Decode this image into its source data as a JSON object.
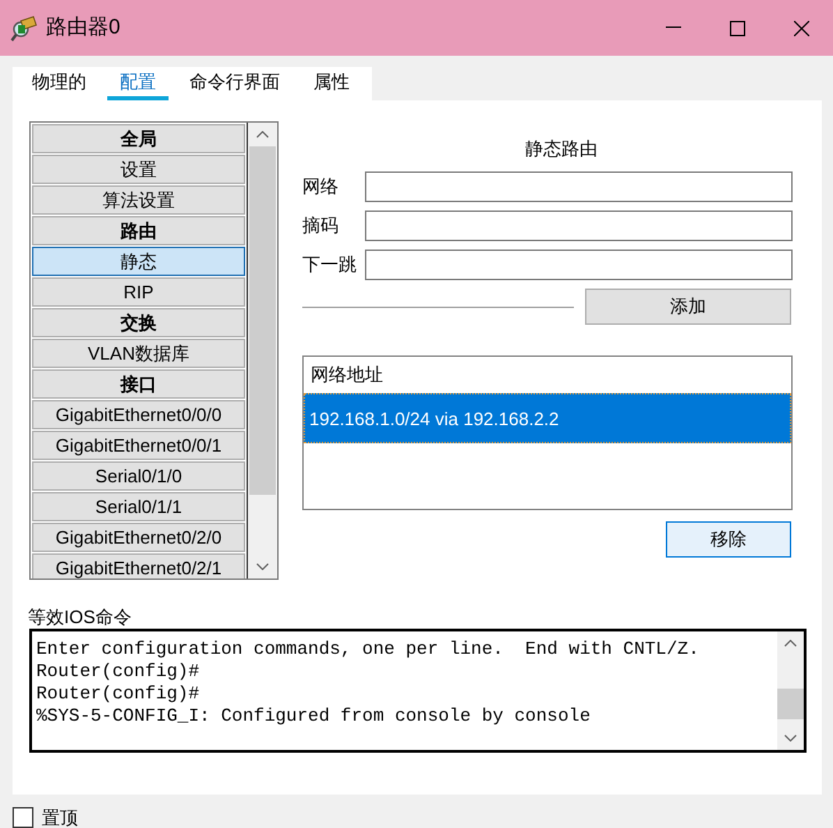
{
  "window": {
    "title": "路由器0"
  },
  "tabs": [
    {
      "label": "物理的",
      "selected": false
    },
    {
      "label": "配置",
      "selected": true
    },
    {
      "label": "命令行界面",
      "selected": false
    },
    {
      "label": "属性",
      "selected": false
    }
  ],
  "sidebar": {
    "items": [
      {
        "label": "全局",
        "kind": "header",
        "selected": false
      },
      {
        "label": "设置",
        "kind": "item",
        "selected": false
      },
      {
        "label": "算法设置",
        "kind": "item",
        "selected": false
      },
      {
        "label": "路由",
        "kind": "header",
        "selected": false
      },
      {
        "label": "静态",
        "kind": "item",
        "selected": true
      },
      {
        "label": "RIP",
        "kind": "item",
        "selected": false
      },
      {
        "label": "交换",
        "kind": "header",
        "selected": false
      },
      {
        "label": "VLAN数据库",
        "kind": "item",
        "selected": false
      },
      {
        "label": "接口",
        "kind": "header",
        "selected": false
      },
      {
        "label": "GigabitEthernet0/0/0",
        "kind": "item",
        "selected": false
      },
      {
        "label": "GigabitEthernet0/0/1",
        "kind": "item",
        "selected": false
      },
      {
        "label": "Serial0/1/0",
        "kind": "item",
        "selected": false
      },
      {
        "label": "Serial0/1/1",
        "kind": "item",
        "selected": false
      },
      {
        "label": "GigabitEthernet0/2/0",
        "kind": "item",
        "selected": false
      },
      {
        "label": "GigabitEthernet0/2/1",
        "kind": "item",
        "selected": false
      }
    ]
  },
  "static_route": {
    "title": "静态路由",
    "fields": [
      {
        "label": "网络"
      },
      {
        "label": "摘码"
      },
      {
        "label": "下一跳"
      }
    ],
    "add_button": "添加",
    "list": {
      "header": "网络地址",
      "rows": [
        {
          "text": "192.168.1.0/24 via 192.168.2.2",
          "selected": true
        }
      ]
    },
    "remove_button": "移除"
  },
  "ios": {
    "label": "等效IOS命令",
    "lines": [
      "Enter configuration commands, one per line.  End with CNTL/Z.",
      "Router(config)#",
      "Router(config)#",
      "%SYS-5-CONFIG_I: Configured from console by console"
    ]
  },
  "always_on_top": {
    "label": "置顶",
    "checked": false
  }
}
